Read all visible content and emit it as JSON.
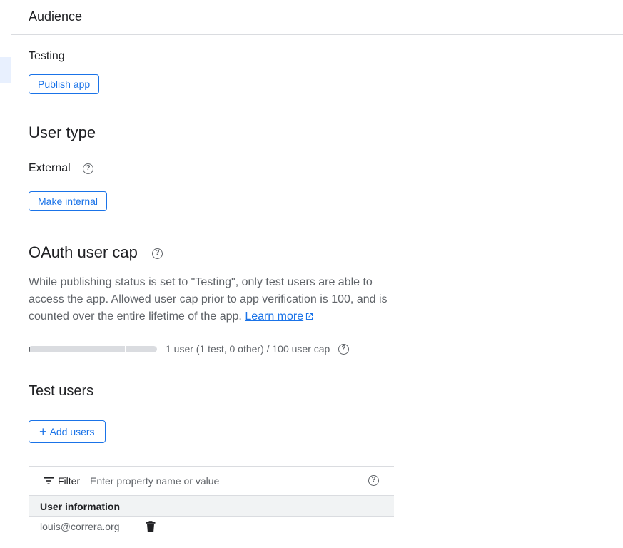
{
  "header": {
    "title": "Audience"
  },
  "publishing": {
    "status": "Testing",
    "publish_button": "Publish app"
  },
  "user_type": {
    "title": "User type",
    "value": "External",
    "make_internal_button": "Make internal"
  },
  "oauth_cap": {
    "title": "OAuth user cap",
    "description": "While publishing status is set to \"Testing\", only test users are able to access the app. Allowed user cap prior to app verification is 100, and is counted over the entire lifetime of the app.",
    "learn_more": "Learn more",
    "usage_text": "1 user (1 test, 0 other) / 100 user cap",
    "usage_fraction": 0.01
  },
  "test_users": {
    "title": "Test users",
    "add_button": "Add users",
    "filter_label": "Filter",
    "filter_placeholder": "Enter property name or value",
    "column_header": "User information",
    "rows": [
      {
        "email": "louis@correra.org"
      }
    ]
  },
  "icons": {
    "help": "help-circle-icon",
    "filter": "filter-list-icon",
    "add": "plus-icon",
    "delete": "trash-icon",
    "external": "open-in-new-icon"
  },
  "colors": {
    "accent": "#1a73e8",
    "text": "#202124",
    "secondary": "#5f6368",
    "border": "#dadce0"
  }
}
